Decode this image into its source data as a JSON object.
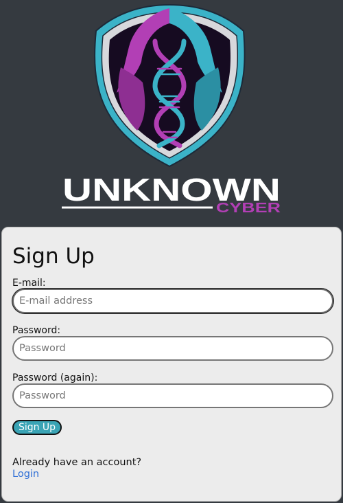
{
  "logo": {
    "word_main": "UNKNOWN",
    "word_sub": "CYBER",
    "colors": {
      "magenta": "#b23fb5",
      "cyan": "#3bb3c8",
      "silver": "#d7d8dc",
      "dark": "#160b21"
    }
  },
  "form": {
    "title": "Sign Up",
    "email": {
      "label": "E-mail:",
      "placeholder": "E-mail address",
      "value": ""
    },
    "password": {
      "label": "Password:",
      "placeholder": "Password",
      "value": ""
    },
    "password_again": {
      "label": "Password (again):",
      "placeholder": "Password",
      "value": ""
    },
    "submit_label": "Sign Up",
    "account_prompt": "Already have an account?",
    "login_link": "Login"
  },
  "theme": {
    "page_background": "#353a40",
    "card_background": "#ececec",
    "button_color": "#3aa4b5",
    "link_color": "#2f6fd6"
  }
}
